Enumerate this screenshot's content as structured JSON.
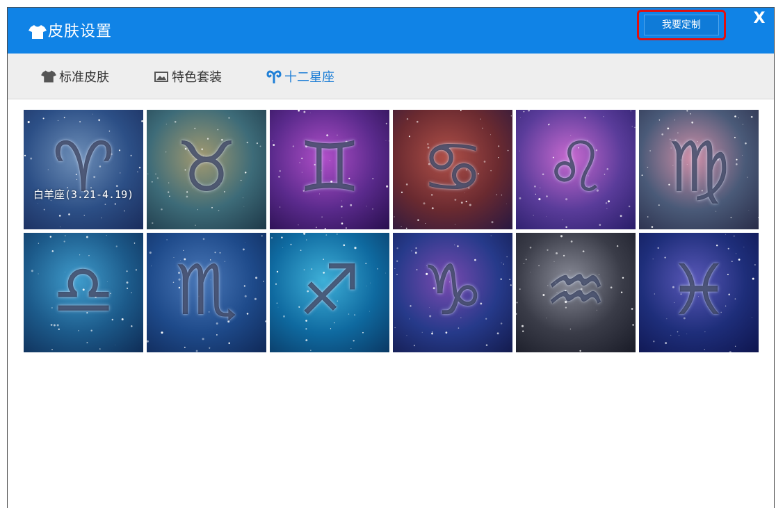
{
  "window": {
    "title": "皮肤设置",
    "custom_button": "我要定制",
    "close_label": "X"
  },
  "tabs": [
    {
      "label": "标准皮肤",
      "icon": "tshirt-icon",
      "active": false
    },
    {
      "label": "特色套装",
      "icon": "picture-icon",
      "active": false
    },
    {
      "label": "十二星座",
      "icon": "aries-icon",
      "active": true
    }
  ],
  "zodiac": [
    {
      "key": "aries",
      "symbol": "♈",
      "caption": "白羊座(3.21-4.19)",
      "colors": [
        "#2c4f86",
        "#6e8fb8",
        "#1b2e5e"
      ]
    },
    {
      "key": "taurus",
      "symbol": "♉",
      "caption": "",
      "colors": [
        "#3d6b78",
        "#a39a70",
        "#1f3a4a"
      ]
    },
    {
      "key": "gemini",
      "symbol": "♊",
      "caption": "",
      "colors": [
        "#5a2a8c",
        "#b04fc8",
        "#2a1050"
      ]
    },
    {
      "key": "cancer",
      "symbol": "♋",
      "caption": "",
      "colors": [
        "#6a2a30",
        "#b05048",
        "#2a1840"
      ]
    },
    {
      "key": "leo",
      "symbol": "♌",
      "caption": "",
      "colors": [
        "#5a3c9a",
        "#c96ad0",
        "#2a1e6a"
      ]
    },
    {
      "key": "virgo",
      "symbol": "♍",
      "caption": "",
      "colors": [
        "#4a5a78",
        "#d090a8",
        "#2a2e4a"
      ]
    },
    {
      "key": "libra",
      "symbol": "♎",
      "caption": "",
      "colors": [
        "#1c5a8a",
        "#3f9ccc",
        "#0f2e58"
      ]
    },
    {
      "key": "scorpio",
      "symbol": "♏",
      "caption": "",
      "colors": [
        "#1e4a8a",
        "#4a78b8",
        "#102a5a"
      ]
    },
    {
      "key": "sagittarius",
      "symbol": "♐",
      "caption": "",
      "colors": [
        "#0f6aa0",
        "#3fb0d8",
        "#0a3a66"
      ]
    },
    {
      "key": "capricorn",
      "symbol": "♑",
      "caption": "",
      "colors": [
        "#263a8a",
        "#7a4ab0",
        "#141c50"
      ]
    },
    {
      "key": "aquarius",
      "symbol": "♒",
      "caption": "",
      "colors": [
        "#3a3c48",
        "#8a8c98",
        "#1a1c28"
      ]
    },
    {
      "key": "pisces",
      "symbol": "♓",
      "caption": "",
      "colors": [
        "#1e2e7a",
        "#5a58b8",
        "#0f1650"
      ]
    }
  ],
  "colors": {
    "titlebar": "#1083e6",
    "active_tab": "#1f7fd6",
    "highlight_border": "#e01010"
  }
}
